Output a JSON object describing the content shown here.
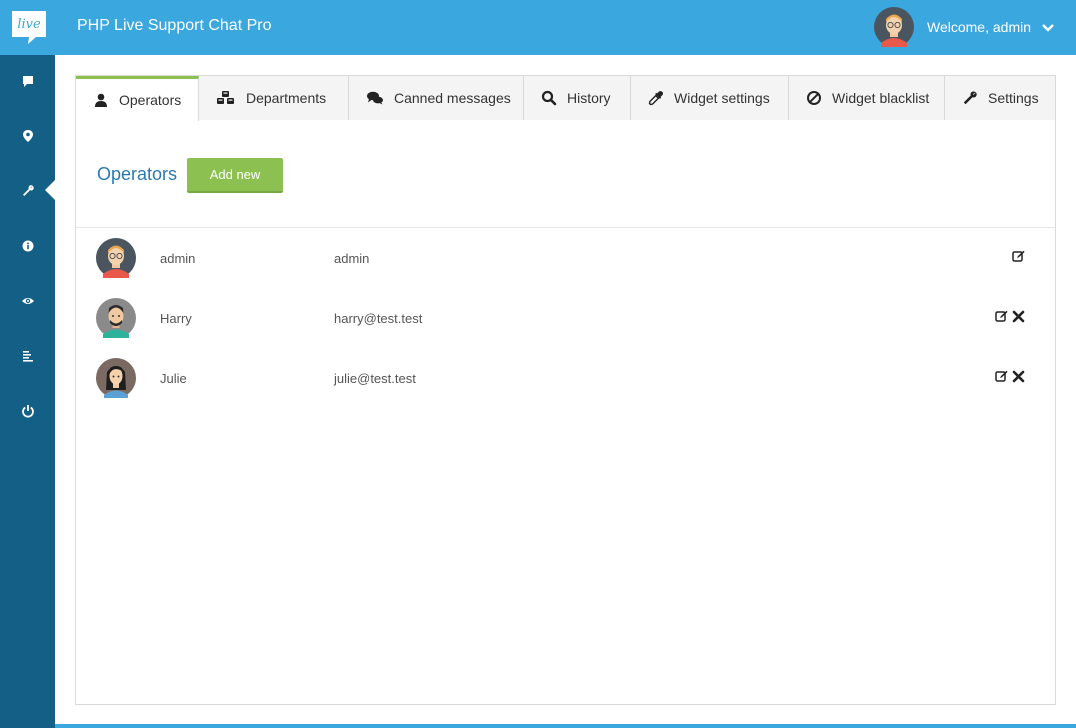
{
  "header": {
    "logo_text": "live",
    "app_title": "PHP Live Support Chat Pro",
    "welcome": "Welcome, admin"
  },
  "sidebar": {
    "items": [
      {
        "icon": "chat-icon"
      },
      {
        "icon": "map-marker-icon"
      },
      {
        "icon": "wrench-icon",
        "active": true
      },
      {
        "icon": "info-icon"
      },
      {
        "icon": "eye-icon"
      },
      {
        "icon": "list-icon"
      },
      {
        "icon": "power-icon"
      }
    ]
  },
  "tabs": [
    {
      "label": "Operators",
      "icon": "user-icon",
      "active": true
    },
    {
      "label": "Departments",
      "icon": "cubes-icon"
    },
    {
      "label": "Canned messages",
      "icon": "comments-icon"
    },
    {
      "label": "History",
      "icon": "search-icon"
    },
    {
      "label": "Widget settings",
      "icon": "eyedropper-icon"
    },
    {
      "label": "Widget blacklist",
      "icon": "ban-icon"
    },
    {
      "label": "Settings",
      "icon": "wrench-icon"
    }
  ],
  "section": {
    "title": "Operators",
    "add_label": "Add new"
  },
  "operators": [
    {
      "name": "admin",
      "email": "admin",
      "avatar": "admin-avatar",
      "can_delete": false
    },
    {
      "name": "Harry",
      "email": "harry@test.test",
      "avatar": "harry-avatar",
      "can_delete": true
    },
    {
      "name": "Julie",
      "email": "julie@test.test",
      "avatar": "julie-avatar",
      "can_delete": true
    }
  ],
  "colors": {
    "topbar": "#3aa7de",
    "sidebar": "#135f85",
    "accent_green": "#8cc152",
    "title_blue": "#2a7ab0"
  }
}
